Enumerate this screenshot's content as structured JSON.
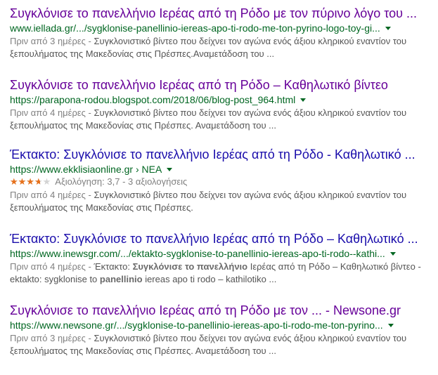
{
  "results": [
    {
      "title": "Συγκλόνισε το πανελλήνιο Ιερέας από τη Ρόδο με τον πύρινο λόγο του ...",
      "url": "www.iellada.gr/.../sygklonise-panellinio-iereas-apo-ti-rodo-me-ton-pyrino-logo-toy-gi...",
      "date": "Πριν από 3 ημέρες - ",
      "snippet_a": "Συγκλονιστικό βίντεο που δείχνει τον αγώνα ενός άξιου κληρικού εναντίον του",
      "snippet_b": "ξεπουλήματος της Μακεδονίας στις Πρέσπες.Αναμετάδοση του ..."
    },
    {
      "title": "Συγκλόνισε το πανελλήνιο Ιερέας από τη Ρόδο – Καθηλωτικό βίντεο",
      "url": "https://parapona-rodou.blogspot.com/2018/06/blog-post_964.html",
      "date": "Πριν από 4 ημέρες - ",
      "snippet_a": "Συγκλονιστικό βίντεο που δείχνει τον αγώνα ενός άξιου κληρικού εναντίον του",
      "snippet_b": "ξεπουλήματος της Μακεδονίας στις Πρέσπες. Αναμετάδοση του ..."
    },
    {
      "title": "Έκτακτο: Συγκλόνισε το πανελλήνιο Ιερέας από τη Ρόδο - Καθηλωτικό ...",
      "url": "https://www.ekklisiaonline.gr › ΝΕΑ",
      "rating_text": "Αξιολόγηση: 3,7 - 3 αξιολογήσεις",
      "rating_value": 3.7,
      "rating_max": 5,
      "date": "Πριν από 4 ημέρες - ",
      "snippet_a": "Συγκλονιστικό βίντεο που δείχνει τον αγώνα ενός άξιου κληρικού εναντίον του",
      "snippet_b": "ξεπουλήματος της Μακεδονίας στις Πρέσπες."
    },
    {
      "title": "Έκτακτο: Συγκλόνισε το πανελλήνιο Ιερέας από τη Ρόδο – Καθηλωτικό ...",
      "url": "https://www.inewsgr.com/.../ektakto-sygklonise-to-panellinio-iereas-apo-ti-rodo--kathi...",
      "date": "Πριν από 4 ημέρες - ",
      "snippet_a1": "Έκτακτο: ",
      "snippet_a_bold": "Συγκλόνισε το πανελλήνιο",
      "snippet_a2": " Ιερέας από τη Ρόδο – Καθηλωτικό βίντεο -",
      "snippet_b1": "ektakto: sygklonise to ",
      "snippet_b_bold": "panellinio",
      "snippet_b2": " iereas apo ti rodo – kathilotiko ..."
    },
    {
      "title": "Συγκλόνισε το πανελλήνιο Ιερέας από τη Ρόδο με τον ... - Newsone.gr",
      "url": "https://www.newsone.gr/.../sygklonise-to-panellinio-iereas-apo-ti-rodo-me-ton-pyrino...",
      "date": "Πριν από 3 ημέρες - ",
      "snippet_a": "Συγκλονιστικό βίντεο που δείχνει τον αγώνα ενός άξιου κληρικού εναντίον του",
      "snippet_b": "ξεπουλήματος της Μακεδονίας στις Πρέσπες. Αναμετάδοση του ..."
    }
  ],
  "colors": {
    "title_visited": "#660099",
    "title_unvisited": "#1a0dab",
    "url": "#006621",
    "snippet": "#545454",
    "star": "#e7711b"
  }
}
